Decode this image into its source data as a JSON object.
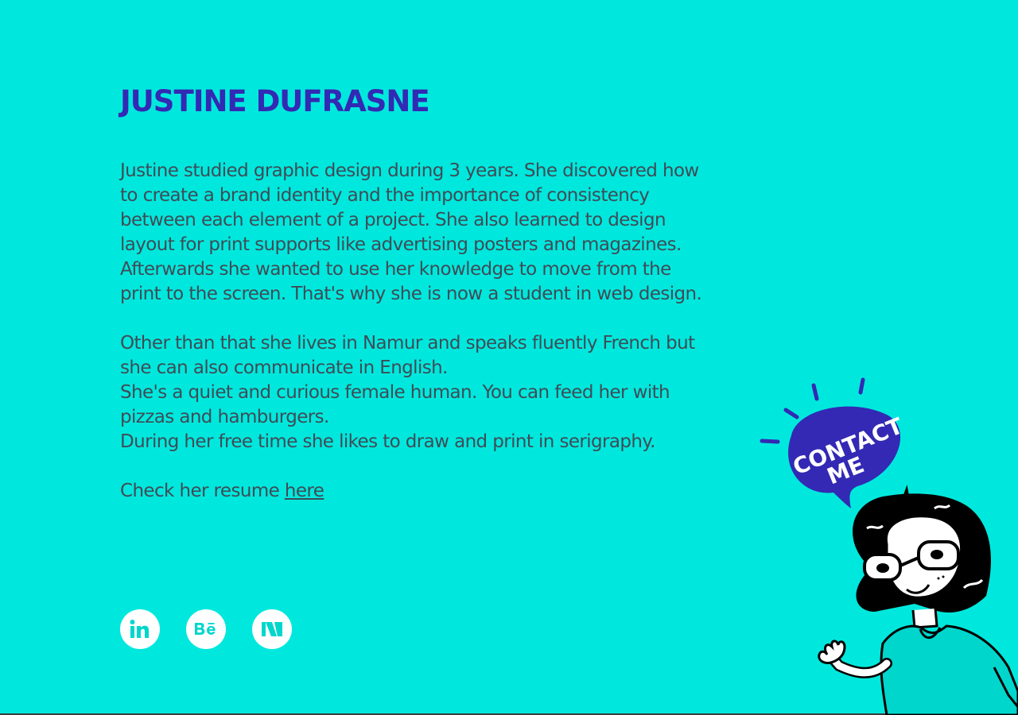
{
  "header": {
    "name": "JUSTINE DUFRASNE"
  },
  "bio": {
    "paragraphs": [
      "Justine studied graphic design during 3 years. She discovered how to create a brand identity and the importance of consistency between each element of a project. She also learned to design layout for print supports like advertising posters and magazines.",
      "Afterwards she wanted to use her knowledge to move from the print to the screen. That's why she is now a student in web design.",
      "Other than that she lives in Namur and speaks fluently French but she can also communicate in English.",
      "She's a quiet and curious female human. You can feed her with pizzas and hamburgers.",
      "During her free time she likes to draw and print in serigraphy."
    ],
    "resume_prefix": "Check her resume ",
    "resume_link": "here"
  },
  "social": {
    "linkedin_icon": "linkedin-icon",
    "behance_icon": "behance-icon",
    "medium_icon": "medium-icon"
  },
  "contact": {
    "bubble_line1": "CONTACT",
    "bubble_line2": "ME",
    "illustration": "girl-with-glasses-waving"
  },
  "colors": {
    "background": "#00e8dd",
    "title": "#3329b4",
    "text": "#3f4c57",
    "bubble": "#3329b4",
    "icon_fill": "#00d6cc"
  }
}
